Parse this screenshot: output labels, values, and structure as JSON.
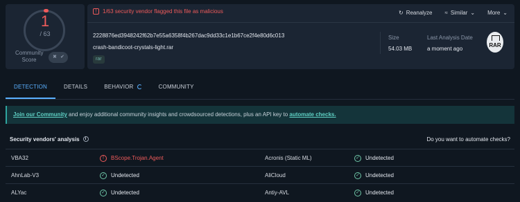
{
  "score": {
    "detected": "1",
    "total": "/ 63",
    "community_label_1": "Community",
    "community_label_2": "Score"
  },
  "alert": {
    "text": "1/63 security vendor flagged this file as malicious"
  },
  "actions": {
    "reanalyze": "Reanalyze",
    "similar": "Similar",
    "more": "More"
  },
  "file": {
    "hash": "2228876ed3948242f62b7e55a6358f4b267dac9dd33c1e1b67ce2f4e80d6c013",
    "name": "crash-bandicoot-crystals-light.rar",
    "tag": "rar",
    "size_label": "Size",
    "size_value": "54.03 MB",
    "analysis_label": "Last Analysis Date",
    "analysis_value": "a moment ago",
    "type_badge": "RAR"
  },
  "tabs": [
    "DETECTION",
    "DETAILS",
    "BEHAVIOR",
    "COMMUNITY"
  ],
  "banner": {
    "link": "Join our Community",
    "middle": " and enjoy additional community insights and crowdsourced detections, plus an API key to ",
    "link2": "automate checks."
  },
  "vendors": {
    "title": "Security vendors' analysis",
    "automate_q": "Do you want to automate checks?",
    "rows": [
      {
        "v1": "VBA32",
        "r1": "BScope.Trojan.Agent",
        "v2": "Acronis (Static ML)",
        "r2": "Undetected"
      },
      {
        "v1": "AhnLab-V3",
        "r1": "Undetected",
        "v2": "AliCloud",
        "r2": "Undetected"
      },
      {
        "v1": "ALYac",
        "r1": "Undetected",
        "v2": "Antiy-AVL",
        "r2": "Undetected"
      }
    ]
  },
  "colors": {
    "malicious": "#ef5b5b",
    "accent": "#5ab0ff",
    "ok": "#6fc7a8"
  }
}
